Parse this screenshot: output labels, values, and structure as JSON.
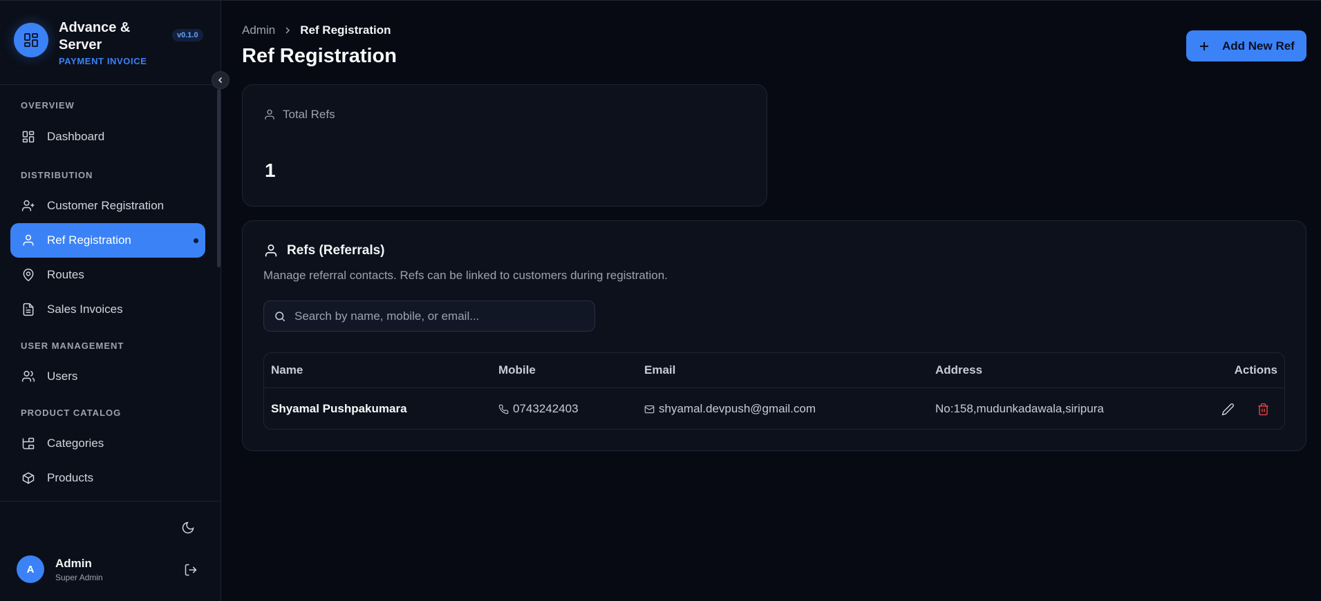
{
  "sidebar": {
    "brand_title": "Advance & Server",
    "brand_subtitle": "PAYMENT INVOICE",
    "version": "v0.1.0",
    "sections": [
      {
        "label": "OVERVIEW",
        "items": [
          {
            "label": "Dashboard",
            "icon": "dashboard-icon"
          }
        ]
      },
      {
        "label": "DISTRIBUTION",
        "items": [
          {
            "label": "Customer Registration",
            "icon": "user-plus-icon"
          },
          {
            "label": "Ref Registration",
            "icon": "user-icon",
            "active": true
          },
          {
            "label": "Routes",
            "icon": "map-pin-icon"
          },
          {
            "label": "Sales Invoices",
            "icon": "file-text-icon"
          }
        ]
      },
      {
        "label": "USER MANAGEMENT",
        "items": [
          {
            "label": "Users",
            "icon": "users-icon"
          }
        ]
      },
      {
        "label": "PRODUCT CATALOG",
        "items": [
          {
            "label": "Categories",
            "icon": "folder-tree-icon"
          },
          {
            "label": "Products",
            "icon": "package-icon"
          }
        ]
      }
    ],
    "user": {
      "initial": "A",
      "name": "Admin",
      "role": "Super Admin"
    }
  },
  "header": {
    "breadcrumb": [
      "Admin",
      "Ref Registration"
    ],
    "title": "Ref Registration",
    "add_button": "Add New Ref"
  },
  "stats": {
    "label": "Total Refs",
    "value": "1"
  },
  "refs": {
    "title": "Refs (Referrals)",
    "description": "Manage referral contacts. Refs can be linked to customers during registration.",
    "search_placeholder": "Search by name, mobile, or email...",
    "columns": [
      "Name",
      "Mobile",
      "Email",
      "Address",
      "Actions"
    ],
    "rows": [
      {
        "name": "Shyamal Pushpakumara",
        "mobile": "0743242403",
        "email": "shyamal.devpush@gmail.com",
        "address": "No:158,mudunkadawala,siripura"
      }
    ]
  },
  "colors": {
    "accent": "#3b82f6",
    "danger": "#ef4444",
    "background": "#070a12"
  }
}
